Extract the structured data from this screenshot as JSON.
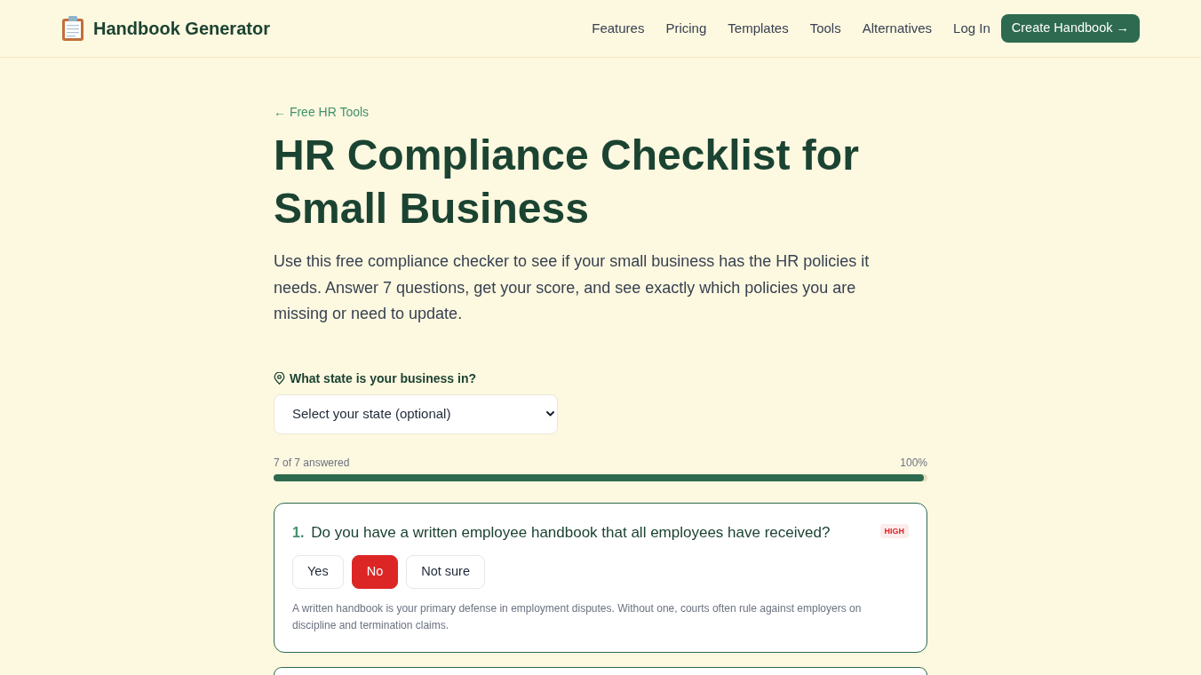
{
  "header": {
    "brand": "Handbook Generator",
    "nav": [
      {
        "label": "Features"
      },
      {
        "label": "Pricing"
      },
      {
        "label": "Templates"
      },
      {
        "label": "Tools"
      },
      {
        "label": "Alternatives"
      },
      {
        "label": "Log In"
      }
    ],
    "cta": "Create Handbook →"
  },
  "breadcrumb": "← Free HR Tools",
  "title": "HR Compliance Checklist for Small Business",
  "intro": "Use this free compliance checker to see if your small business has the HR policies it needs. Answer 7 questions, get your score, and see exactly which policies you are missing or need to update.",
  "state_field": {
    "label": "What state is your business in?",
    "selected_option": "Select your state (optional)"
  },
  "progress": {
    "label": "7 of 7 answered",
    "percent": "100%",
    "level": 1
  },
  "questions": [
    {
      "number": "1.",
      "text": "Do you have a written employee handbook that all employees have received?",
      "priority": "HIGH",
      "options": [
        {
          "label": "Yes",
          "selected": false
        },
        {
          "label": "No",
          "selected": true
        },
        {
          "label": "Not sure",
          "selected": false
        }
      ],
      "note": "A written handbook is your primary defense in employment disputes. Without one, courts often rule against employers on discipline and termination claims."
    }
  ]
}
